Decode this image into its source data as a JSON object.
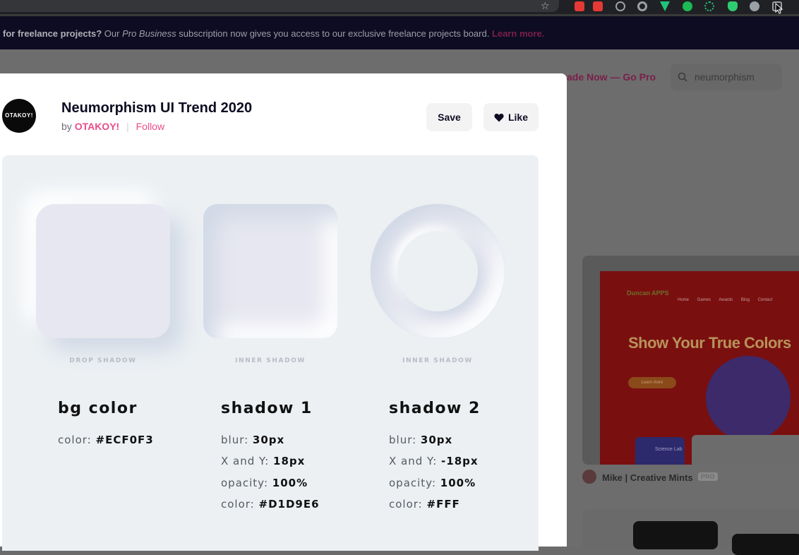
{
  "browser": {
    "extension_colors": [
      "#e53935",
      "#e53935",
      "#9aa0a6",
      "#9aa0a6",
      "#21c27a",
      "#1db954",
      "#21c27a",
      "#2ecc71",
      "#9aa0a6",
      "#9aa0a6"
    ]
  },
  "banner": {
    "bold_text": "for freelance projects?",
    "text_a": " Our ",
    "italic_text": "Pro Business",
    "text_b": " subscription now gives you access to our exclusive freelance projects board. ",
    "link": "Learn more."
  },
  "background": {
    "upgrade_link": "ade Now — Go Pro",
    "search_value": "neumorphism",
    "card": {
      "logo_text": "Duncan APPS",
      "nav": "Home Games Awards Blog Contact",
      "headline": "Show Your True Colors",
      "cta": "Learn more",
      "panel_label": "Science Lab"
    },
    "author": "Mike | Creative Mints",
    "author_badge": "PRO"
  },
  "modal": {
    "avatar_text": "OTAKOY!",
    "title": "Neumorphism UI Trend 2020",
    "by": "by",
    "author": "OTAKOY!",
    "separator": "|",
    "follow": "Follow",
    "save_label": "Save",
    "like_label": "Like"
  },
  "shot": {
    "captions": [
      "DROP SHADOW",
      "INNER SHADOW",
      "INNER SHADOW"
    ],
    "columns": [
      {
        "heading": "bg color",
        "props": [
          {
            "key": "color: ",
            "value": "#ECF0F3"
          }
        ]
      },
      {
        "heading": "shadow 1",
        "props": [
          {
            "key": "blur: ",
            "value": "30px"
          },
          {
            "key": "X and Y: ",
            "value": "18px"
          },
          {
            "key": "opacity: ",
            "value": "100%"
          },
          {
            "key": "color: ",
            "value": "#D1D9E6"
          }
        ]
      },
      {
        "heading": "shadow 2",
        "props": [
          {
            "key": "blur: ",
            "value": "30px"
          },
          {
            "key": "X and Y: ",
            "value": "-18px"
          },
          {
            "key": "opacity: ",
            "value": "100%"
          },
          {
            "key": "color: ",
            "value": "#FFF"
          }
        ]
      }
    ]
  },
  "colors": {
    "accent": "#ea4c89",
    "bg_color": "#ECF0F3",
    "shadow_dark": "#D1D9E6",
    "shadow_light": "#FFF"
  }
}
